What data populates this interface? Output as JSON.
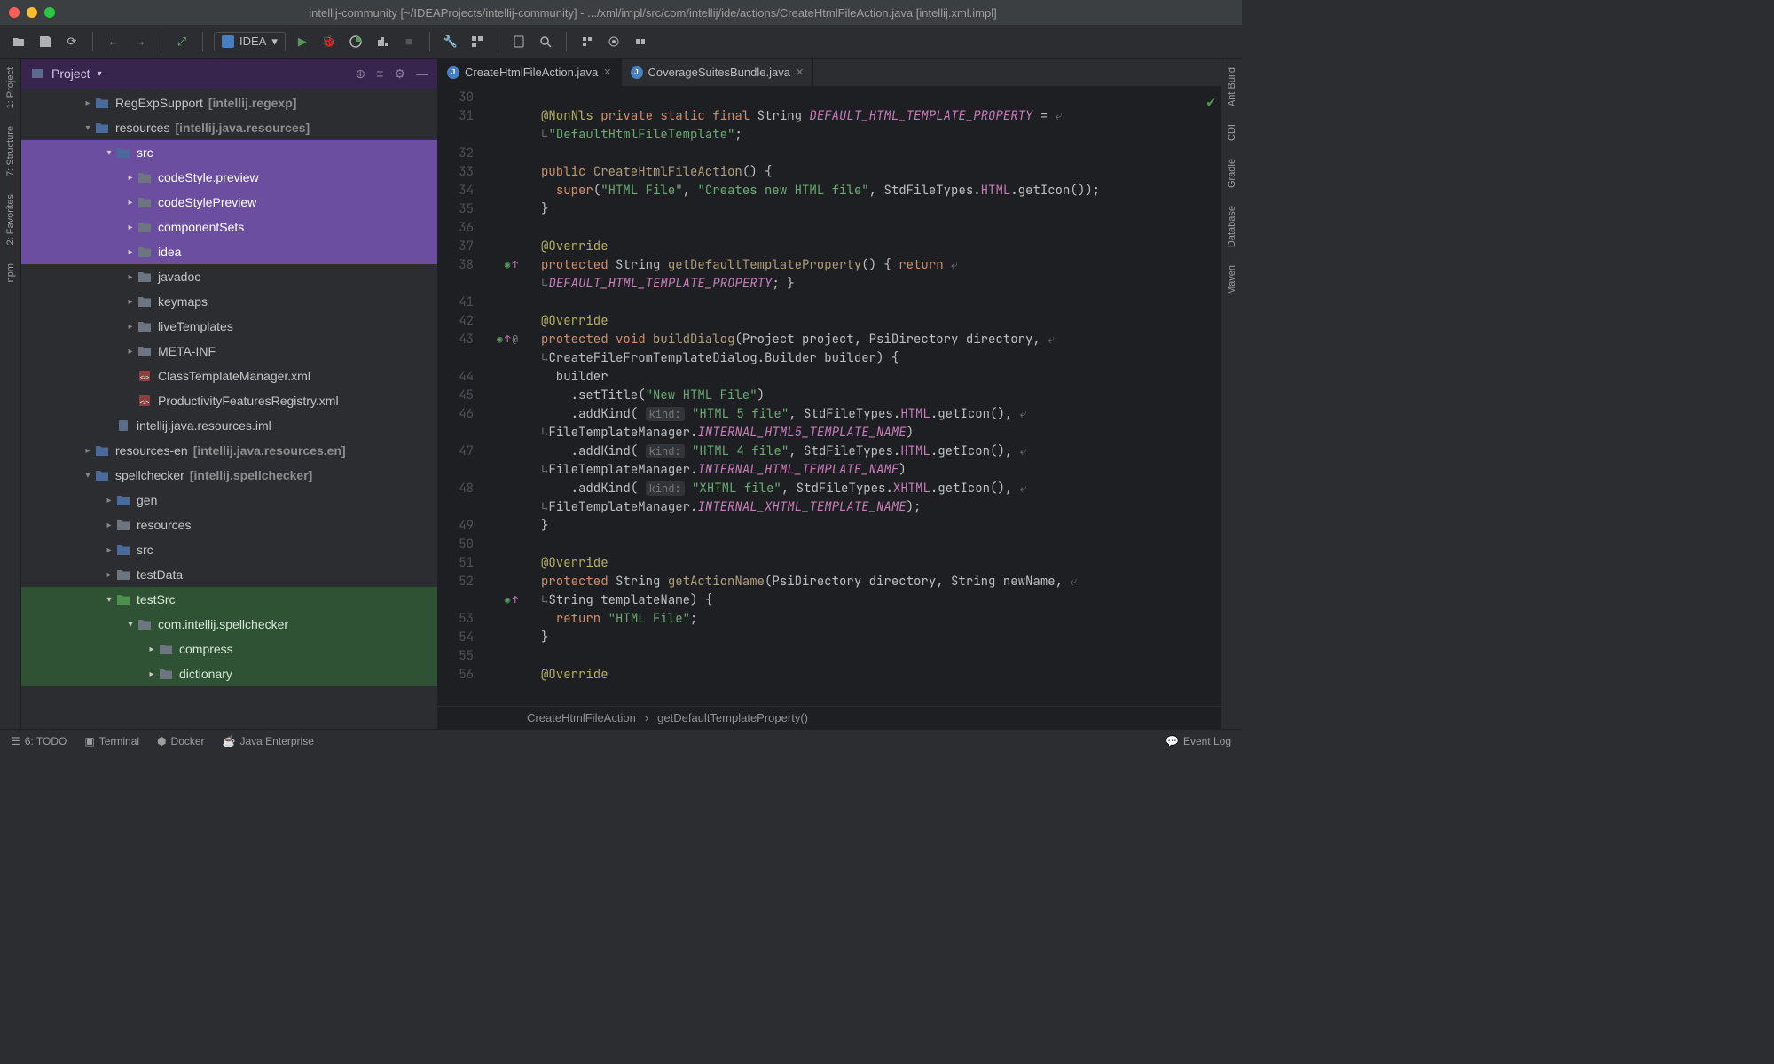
{
  "title": "intellij-community [~/IDEAProjects/intellij-community] - .../xml/impl/src/com/intellij/ide/actions/CreateHtmlFileAction.java [intellij.xml.impl]",
  "runConfig": "IDEA",
  "projectPanel": {
    "title": "Project"
  },
  "leftRail": [
    "1: Project",
    "7: Structure",
    "2: Favorites",
    "npm"
  ],
  "rightRail": [
    "Ant Build",
    "CDI",
    "Gradle",
    "Database",
    "Maven"
  ],
  "tabs": [
    {
      "label": "CreateHtmlFileAction.java",
      "active": true
    },
    {
      "label": "CoverageSuitesBundle.java",
      "active": false
    }
  ],
  "tree": [
    {
      "d": 2,
      "a": "▸",
      "ic": "folder-b",
      "t": "RegExpSupport",
      "m": "[intellij.regexp]",
      "sel": ""
    },
    {
      "d": 2,
      "a": "▾",
      "ic": "folder-b",
      "t": "resources",
      "m": "[intellij.java.resources]",
      "sel": ""
    },
    {
      "d": 3,
      "a": "▾",
      "ic": "folder-b",
      "t": "src",
      "m": "",
      "sel": "p"
    },
    {
      "d": 4,
      "a": "▸",
      "ic": "folder-g",
      "t": "codeStyle.preview",
      "m": "",
      "sel": "p"
    },
    {
      "d": 4,
      "a": "▸",
      "ic": "folder-g",
      "t": "codeStylePreview",
      "m": "",
      "sel": "p"
    },
    {
      "d": 4,
      "a": "▸",
      "ic": "folder-g",
      "t": "componentSets",
      "m": "",
      "sel": "p"
    },
    {
      "d": 4,
      "a": "▸",
      "ic": "folder-g",
      "t": "idea",
      "m": "",
      "sel": "p"
    },
    {
      "d": 4,
      "a": "▸",
      "ic": "folder-g",
      "t": "javadoc",
      "m": "",
      "sel": ""
    },
    {
      "d": 4,
      "a": "▸",
      "ic": "folder-g",
      "t": "keymaps",
      "m": "",
      "sel": ""
    },
    {
      "d": 4,
      "a": "▸",
      "ic": "folder-g",
      "t": "liveTemplates",
      "m": "",
      "sel": ""
    },
    {
      "d": 4,
      "a": "▸",
      "ic": "folder-g",
      "t": "META-INF",
      "m": "",
      "sel": ""
    },
    {
      "d": 4,
      "a": "",
      "ic": "xml",
      "t": "ClassTemplateManager.xml",
      "m": "",
      "sel": ""
    },
    {
      "d": 4,
      "a": "",
      "ic": "xml",
      "t": "ProductivityFeaturesRegistry.xml",
      "m": "",
      "sel": ""
    },
    {
      "d": 3,
      "a": "",
      "ic": "iml",
      "t": "intellij.java.resources.iml",
      "m": "",
      "sel": ""
    },
    {
      "d": 2,
      "a": "▸",
      "ic": "folder-b",
      "t": "resources-en",
      "m": "[intellij.java.resources.en]",
      "sel": ""
    },
    {
      "d": 2,
      "a": "▾",
      "ic": "folder-b",
      "t": "spellchecker",
      "m": "[intellij.spellchecker]",
      "sel": ""
    },
    {
      "d": 3,
      "a": "▸",
      "ic": "folder-b",
      "t": "gen",
      "m": "",
      "sel": ""
    },
    {
      "d": 3,
      "a": "▸",
      "ic": "folder-g",
      "t": "resources",
      "m": "",
      "sel": ""
    },
    {
      "d": 3,
      "a": "▸",
      "ic": "folder-b",
      "t": "src",
      "m": "",
      "sel": ""
    },
    {
      "d": 3,
      "a": "▸",
      "ic": "folder-g",
      "t": "testData",
      "m": "",
      "sel": ""
    },
    {
      "d": 3,
      "a": "▾",
      "ic": "folder-gn",
      "t": "testSrc",
      "m": "",
      "sel": "g"
    },
    {
      "d": 4,
      "a": "▾",
      "ic": "folder-g",
      "t": "com.intellij.spellchecker",
      "m": "",
      "sel": "g"
    },
    {
      "d": 5,
      "a": "▸",
      "ic": "folder-g",
      "t": "compress",
      "m": "",
      "sel": "g"
    },
    {
      "d": 5,
      "a": "▸",
      "ic": "folder-g",
      "t": "dictionary",
      "m": "",
      "sel": "g"
    }
  ],
  "lineNumbers": [
    "30",
    "31",
    "",
    "32",
    "33",
    "34",
    "35",
    "36",
    "37",
    "38",
    "",
    "41",
    "42",
    "43",
    "",
    "44",
    "45",
    "46",
    "",
    "47",
    "",
    "48",
    "",
    "49",
    "50",
    "51",
    "52",
    "",
    "53",
    "54",
    "55",
    "56"
  ],
  "gutterMarks": {
    "9": "o↑",
    "13": "o↑ @",
    "27": "o↑"
  },
  "code": [
    "",
    "<span class='ann'>@NonNls</span> <span class='kw'>private static final</span> String <span class='cnst'>DEFAULT_HTML_TEMPLATE_PROPERTY</span> = <span class='wrap'>⤶</span>",
    "<span class='wrap'>↳</span><span class='str'>\"DefaultHtmlFileTemplate\"</span>;",
    "",
    "<span class='kw'>public</span> <span class='fn'>CreateHtmlFileAction</span>() {",
    "  <span class='kw'>super</span>(<span class='str'>\"HTML File\"</span>, <span class='str'>\"Creates new HTML file\"</span>, StdFileTypes.<span class='fi'>HTML</span>.getIcon());",
    "}",
    "",
    "<span class='ann'>@Override</span>",
    "<span class='kw'>protected</span> String <span class='fn'>getDefaultTemplateProperty</span>() { <span class='kw'>return</span> <span class='wrap'>⤶</span>",
    "<span class='wrap'>↳</span><span class='cnst'>DEFAULT_HTML_TEMPLATE_PROPERTY</span>; }",
    "",
    "<span class='ann'>@Override</span>",
    "<span class='kw'>protected void</span> <span class='fn'>buildDialog</span>(Project project, PsiDirectory directory, <span class='wrap'>⤶</span>",
    "<span class='wrap'>↳</span>CreateFileFromTemplateDialog.Builder builder) {",
    "  builder",
    "    .setTitle(<span class='str'>\"New HTML File\"</span>)",
    "    .addKind( <span class='param-hint'>kind:</span> <span class='str'>\"HTML 5 file\"</span>, StdFileTypes.<span class='fi'>HTML</span>.getIcon(), <span class='wrap'>⤶</span>",
    "<span class='wrap'>↳</span>FileTemplateManager.<span class='cnst'>INTERNAL_HTML5_TEMPLATE_NAME</span>)",
    "    .addKind( <span class='param-hint'>kind:</span> <span class='str'>\"HTML 4 file\"</span>, StdFileTypes.<span class='fi'>HTML</span>.getIcon(), <span class='wrap'>⤶</span>",
    "<span class='wrap'>↳</span>FileTemplateManager.<span class='cnst'>INTERNAL_HTML_TEMPLATE_NAME</span>)",
    "    .addKind( <span class='param-hint'>kind:</span> <span class='str'>\"XHTML file\"</span>, StdFileTypes.<span class='fi'>XHTML</span>.getIcon(), <span class='wrap'>⤶</span>",
    "<span class='wrap'>↳</span>FileTemplateManager.<span class='cnst'>INTERNAL_XHTML_TEMPLATE_NAME</span>);",
    "}",
    "",
    "<span class='ann'>@Override</span>",
    "<span class='kw'>protected</span> String <span class='fn'>getActionName</span>(PsiDirectory directory, String newName, <span class='wrap'>⤶</span>",
    "<span class='wrap'>↳</span>String templateName) {",
    "  <span class='kw'>return</span> <span class='str'>\"HTML File\"</span>;",
    "}",
    "",
    "<span class='ann'>@Override</span>"
  ],
  "breadcrumb": [
    "CreateHtmlFileAction",
    "›",
    "getDefaultTemplateProperty()"
  ],
  "statusBar": {
    "left": [
      "6: TODO",
      "Terminal",
      "Docker",
      "Java Enterprise"
    ],
    "right": [
      "Event Log"
    ]
  }
}
